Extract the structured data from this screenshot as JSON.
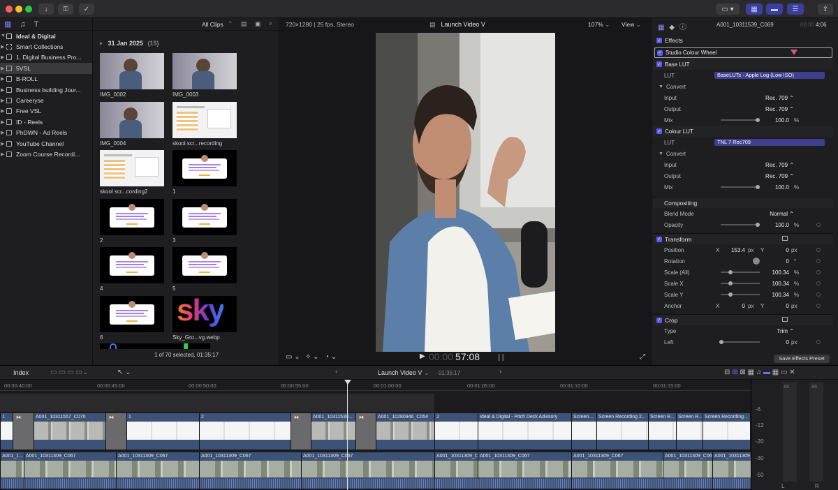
{
  "toolbar": {
    "buttons": [
      "import-icon",
      "key-icon",
      "checkmark-icon"
    ],
    "right_buttons": [
      "media-icon",
      "chevron-down-icon",
      "browser-icon",
      "timeline-icon",
      "inspector-icon",
      "share-icon"
    ]
  },
  "sidebar": {
    "library": "Ideal & Digital",
    "items": [
      {
        "label": "Smart Collections",
        "selected": false
      },
      {
        "label": "1. Digital Business Pro...",
        "selected": false
      },
      {
        "label": "5VSL",
        "selected": true
      },
      {
        "label": "B-ROLL",
        "selected": false
      },
      {
        "label": "Business building Jour...",
        "selected": false
      },
      {
        "label": "Careeryse",
        "selected": false
      },
      {
        "label": "Free VSL",
        "selected": false
      },
      {
        "label": "ID - Reels",
        "selected": false
      },
      {
        "label": "PhDWN - Ad Reels",
        "selected": false
      },
      {
        "label": "YouTube Channel",
        "selected": false
      },
      {
        "label": "Zoom Course Recordi...",
        "selected": false
      }
    ]
  },
  "browser": {
    "filter": "All Clips",
    "date_header": "31 Jan 2025",
    "date_count": "(15)",
    "clips": [
      {
        "label": "IMG_0002",
        "kind": "photo"
      },
      {
        "label": "IMG_0003",
        "kind": "photo"
      },
      {
        "label": "IMG_0004",
        "kind": "photo"
      },
      {
        "label": "skool scr...recording",
        "kind": "screen"
      },
      {
        "label": "skool scr...cording2",
        "kind": "screen"
      },
      {
        "label": "1",
        "kind": "card"
      },
      {
        "label": "2",
        "kind": "card"
      },
      {
        "label": "3",
        "kind": "card"
      },
      {
        "label": "4",
        "kind": "card"
      },
      {
        "label": "5",
        "kind": "card"
      },
      {
        "label": "6",
        "kind": "card"
      },
      {
        "label": "Sky_Gro...vg.webp",
        "kind": "sky"
      }
    ],
    "sky_text": "sky",
    "status": "1 of 70 selected, 01:35:17"
  },
  "viewer": {
    "format": "720×1280 | 25 fps, Stereo",
    "title": "Launch Video V",
    "zoom": "107%",
    "view": "View",
    "timecode_dim": "00:00",
    "timecode": "57:08"
  },
  "inspector": {
    "clip_name": "A001_10311539_C069",
    "duration_dim": "00:00",
    "duration": "4:06",
    "effects": "Effects",
    "studio_wheel": "Studio Colour Wheel",
    "base_lut": "Base LUT",
    "lut_label": "LUT",
    "base_lut_value": "BaseLUTs - Apple Log (Low ISO)",
    "convert": "Convert",
    "input": "Input",
    "output": "Output",
    "mix": "Mix",
    "rec709": "Rec. 709 ⌃",
    "mix_value": "100.0",
    "percent": "%",
    "colour_lut": "Colour LUT",
    "colour_lut_value": "TNL 7 Rec709",
    "compositing": "Compositing",
    "blend_mode": "Blend Mode",
    "blend_value": "Normal ⌃",
    "opacity": "Opacity",
    "opacity_value": "100.0",
    "transform": "Transform",
    "position": "Position",
    "x": "X",
    "y": "Y",
    "pos_x": "153.4",
    "px": "px",
    "pos_y": "0",
    "rotation": "Rotation",
    "rot_value": "0",
    "deg": "°",
    "scale_all": "Scale (All)",
    "scale_x": "Scale X",
    "scale_y": "Scale Y",
    "scale_value": "100.34",
    "anchor": "Anchor",
    "anchor_x": "0",
    "anchor_y": "0",
    "crop": "Crop",
    "type": "Type",
    "type_value": "Trim ⌃",
    "left": "Left",
    "left_value": "0",
    "save_preset": "Save Effects Preset"
  },
  "timeline": {
    "index": "Index",
    "title": "Launch Video V",
    "duration": "01:35:17",
    "ruler": [
      "00:00:40:00",
      "00:00:45:00",
      "00:00:50:00",
      "00:00:55:00",
      "00:01:00:00",
      "00:01:05:00",
      "00:01:10:00",
      "00:01:15:00"
    ],
    "video_clips": [
      {
        "name": "1",
        "type": "white"
      },
      {
        "name": "",
        "type": "gap"
      },
      {
        "name": "A001_10311557_C070",
        "type": "photo"
      },
      {
        "name": "",
        "type": "gap"
      },
      {
        "name": "1",
        "type": "white"
      },
      {
        "name": "2",
        "type": "white"
      },
      {
        "name": "",
        "type": "gap"
      },
      {
        "name": "A001_10311539...",
        "type": "photo"
      },
      {
        "name": "",
        "type": "gap"
      },
      {
        "name": "A001_10280946_C054",
        "type": "photo"
      },
      {
        "name": "2",
        "type": "white"
      },
      {
        "name": "Ideal & Digital - Pitch Deck Advisory",
        "type": "white"
      },
      {
        "name": "Screen...",
        "type": "white"
      },
      {
        "name": "Screen Recording 2...",
        "type": "white"
      },
      {
        "name": "Screen R...",
        "type": "white"
      },
      {
        "name": "Screen R...",
        "type": "white"
      },
      {
        "name": "Screen Recording...",
        "type": "white"
      }
    ],
    "audio_clips": [
      "A001_1...",
      "A001_10311309_C067",
      "A001_10311309_C067",
      "A001_10311309_C067",
      "A001_10311309_C067",
      "A001_10311309_C067",
      "A001_10311309_C067",
      "A001_10311309_C067",
      "A001_10311309_C067",
      "A001_10311309_C067"
    ],
    "meter_labels": [
      "-00",
      "-00",
      "-6",
      "-12",
      "-20",
      "-30",
      "-50",
      "L",
      "R"
    ]
  }
}
